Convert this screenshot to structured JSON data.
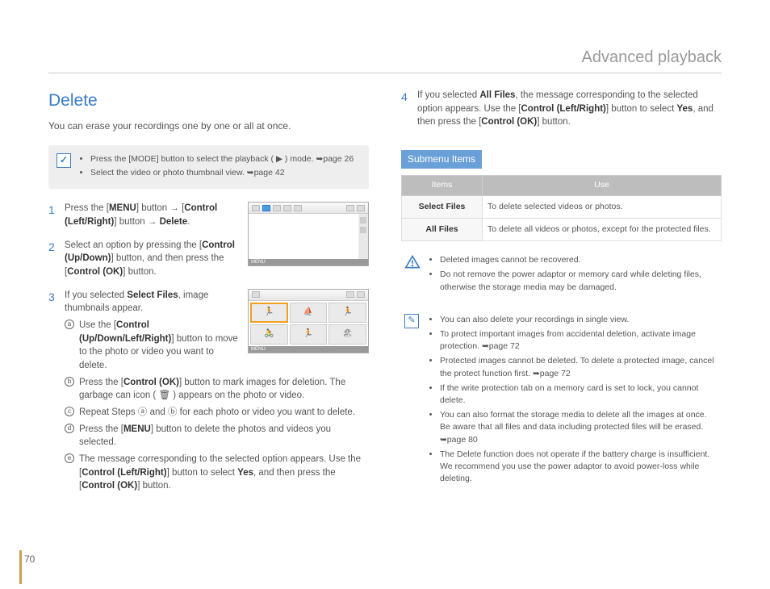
{
  "header": {
    "title": "Advanced playback"
  },
  "page_number": "70",
  "left": {
    "title": "Delete",
    "intro": "You can erase your recordings one by one or all at once.",
    "tipbox": {
      "items": [
        "Press the [MODE] button to select the playback ( ▶ ) mode. ➥page 26",
        "Select the video or photo thumbnail view. ➥page 42"
      ]
    },
    "steps": {
      "s1": {
        "text_a": "Press the [",
        "b1": "MENU",
        "text_b": "] button → [",
        "b2": "Control (Left/Right)",
        "text_c": "] button → ",
        "b3": "Delete",
        "text_d": "."
      },
      "s2": {
        "text_a": "Select an option by pressing the [",
        "b1": "Control (Up/Down)",
        "text_b": "] button, and then press the [",
        "b2": "Control (OK)",
        "text_c": "] button."
      },
      "s3": {
        "intro_a": "If you selected ",
        "b_intro": "Select Files",
        "intro_b": ", image thumbnails appear.",
        "sub": {
          "a": {
            "t1": "Use the [",
            "b1": "Control (Up/Down/Left/Right)",
            "t2": "] button to move to the photo or video you want to delete."
          },
          "b": {
            "t1": "Press the [",
            "b1": "Control (OK)",
            "t2": "] button to mark images for deletion. The garbage can icon ( 🗑 ) appears on the photo or video."
          },
          "c": {
            "t1": "Repeat Steps ⓐ and ⓑ for each photo or video you want to delete."
          },
          "d": {
            "t1": "Press the [",
            "b1": "MENU",
            "t2": "] button to delete the photos and videos you selected."
          },
          "e": {
            "t1": "The message corresponding to the selected option appears. Use the [",
            "b1": "Control (Left/Right)",
            "t2": "] button to select ",
            "b2": "Yes",
            "t3": ", and then press the [",
            "b3": "Control (OK)",
            "t4": "] button."
          }
        }
      }
    }
  },
  "right": {
    "step4": {
      "t1": "If you selected ",
      "b1": "All Files",
      "t2": ", the message corresponding to the selected option appears. Use the [",
      "b2": "Control (Left/Right)",
      "t3": "] button to select ",
      "b3": "Yes",
      "t4": ", and then press the [",
      "b4": "Control (OK)",
      "t5": "] button."
    },
    "submenu_label": "Submenu Items",
    "table": {
      "head_items": "Items",
      "head_use": "Use",
      "rows": [
        {
          "k": "Select Files",
          "v": "To delete selected videos or photos."
        },
        {
          "k": "All Files",
          "v": "To delete all videos or photos, except for the protected files."
        }
      ]
    },
    "warning": {
      "items": [
        "Deleted images cannot be recovered.",
        "Do not remove the power adaptor or memory card while deleting files, otherwise the storage media may be damaged."
      ]
    },
    "info": {
      "items": [
        "You can also delete your recordings in single view.",
        "To protect important images from accidental deletion, activate image protection. ➥page 72",
        "Protected images cannot be deleted. To delete a protected image, cancel the protect function first. ➥page 72",
        "If the write protection tab on a memory card is set to lock, you cannot delete.",
        "You can also format the storage media to delete all the images at once. Be aware that all files and data including protected files will be erased. ➥page 80",
        "The Delete function does not operate if the battery charge is insufficient. We recommend you use the power adaptor to avoid power-loss while deleting."
      ]
    }
  }
}
